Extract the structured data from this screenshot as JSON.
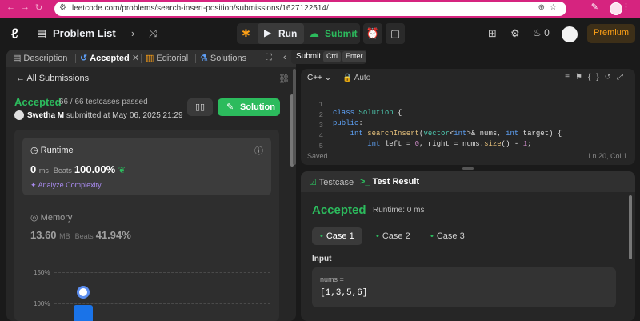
{
  "browser": {
    "url": "leetcode.com/problems/search-insert-position/submissions/1627122514/"
  },
  "topbar": {
    "problem_list": "Problem List",
    "run_label": "Run",
    "submit_label": "Submit",
    "streak_count": "0",
    "premium_label": "Premium"
  },
  "tabs": [
    {
      "label": "Description",
      "icon": "description-icon"
    },
    {
      "label": "Accepted",
      "icon": "history-icon"
    },
    {
      "label": "Editorial",
      "icon": "book-icon"
    },
    {
      "label": "Solutions",
      "icon": "flask-icon"
    }
  ],
  "tooltip": {
    "text": "Submit",
    "key1": "Ctrl",
    "key2": "Enter"
  },
  "submission": {
    "back_label": "All Submissions",
    "status": "Accepted",
    "testcases": "66 / 66 testcases passed",
    "user": "Swetha M",
    "submitted_text": "submitted at May 06, 2025 21:29",
    "solution_label": "Solution"
  },
  "runtime": {
    "label": "Runtime",
    "value": "0",
    "unit": "ms",
    "beats_label": "Beats",
    "beats_value": "100.00%",
    "analyze_label": "Analyze Complexity"
  },
  "memory": {
    "label": "Memory",
    "value": "13.60",
    "unit": "MB",
    "beats_label": "Beats",
    "beats_value": "41.94%"
  },
  "chart_labels": {
    "top": "150%",
    "bottom": "100%"
  },
  "editor": {
    "language": "C++",
    "mode": "Auto",
    "saved_label": "Saved",
    "position": "Ln 20, Col 1",
    "lines": [
      {
        "n": "1",
        "text": "class Solution {"
      },
      {
        "n": "2",
        "text": "public:"
      },
      {
        "n": "3",
        "text": "    int searchInsert(vector<int>& nums, int target) {"
      },
      {
        "n": "4",
        "text": "        int left = 0, right = nums.size() - 1;"
      },
      {
        "n": "5",
        "text": ""
      }
    ]
  },
  "result": {
    "testcase_tab": "Testcase",
    "result_tab": "Test Result",
    "status": "Accepted",
    "runtime": "Runtime: 0 ms",
    "cases": [
      "Case 1",
      "Case 2",
      "Case 3"
    ],
    "input_label": "Input",
    "var_name": "nums =",
    "var_value": "[1,3,5,6]"
  },
  "colors": {
    "accent_green": "#2cbb5d",
    "premium_orange": "#ffa116",
    "brand_pink": "#d6247f"
  }
}
